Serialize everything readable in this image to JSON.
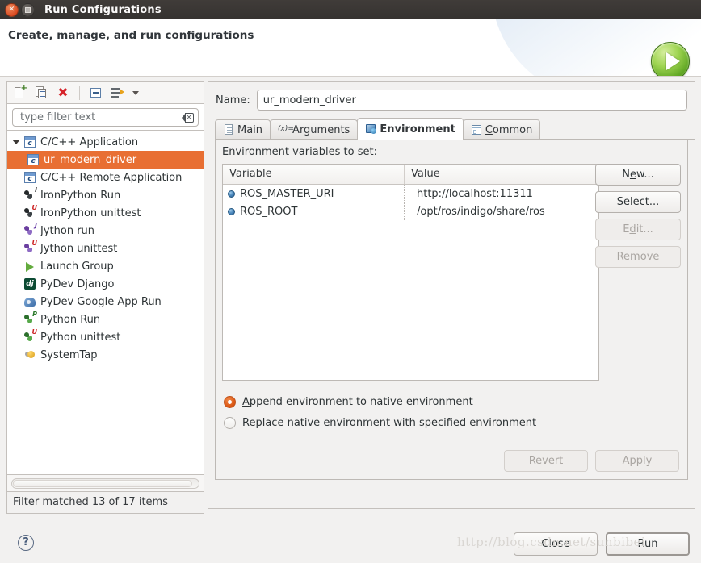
{
  "window": {
    "title": "Run Configurations",
    "close_icon": "close-icon",
    "maximize_icon": "maximize-icon"
  },
  "header": {
    "title": "Create, manage, and run configurations",
    "run_badge_icon": "run-play-icon"
  },
  "left_panel": {
    "toolbar": [
      {
        "name": "new-configuration-icon",
        "label": "New launch configuration"
      },
      {
        "name": "duplicate-configuration-icon",
        "label": "Duplicate"
      },
      {
        "name": "delete-configuration-icon",
        "label": "Delete"
      },
      {
        "name": "collapse-all-icon",
        "label": "Collapse All"
      },
      {
        "name": "filter-launch-configurations-icon",
        "label": "Filter"
      },
      {
        "name": "chevron-down-icon",
        "label": "View Menu"
      }
    ],
    "filter": {
      "placeholder": "type filter text",
      "value": "",
      "clear_icon": "clear-field-icon"
    },
    "tree": [
      {
        "label": "C/C++ Application",
        "icon": "c-app-icon",
        "level": 0,
        "expanded": true,
        "selected": false
      },
      {
        "label": "ur_modern_driver",
        "icon": "c-app-icon",
        "level": 1,
        "expanded": false,
        "selected": true
      },
      {
        "label": "C/C++ Remote Application",
        "icon": "c-app-icon",
        "level": 0,
        "expanded": false,
        "selected": false
      },
      {
        "label": "IronPython Run",
        "icon": "ironpython-run-icon",
        "level": 0,
        "expanded": false,
        "selected": false
      },
      {
        "label": "IronPython unittest",
        "icon": "ironpython-unittest-icon",
        "level": 0,
        "expanded": false,
        "selected": false
      },
      {
        "label": "Jython run",
        "icon": "jython-run-icon",
        "level": 0,
        "expanded": false,
        "selected": false
      },
      {
        "label": "Jython unittest",
        "icon": "jython-unittest-icon",
        "level": 0,
        "expanded": false,
        "selected": false
      },
      {
        "label": "Launch Group",
        "icon": "launch-group-icon",
        "level": 0,
        "expanded": false,
        "selected": false
      },
      {
        "label": "PyDev Django",
        "icon": "pydev-django-icon",
        "level": 0,
        "expanded": false,
        "selected": false
      },
      {
        "label": "PyDev Google App Run",
        "icon": "pydev-google-app-icon",
        "level": 0,
        "expanded": false,
        "selected": false
      },
      {
        "label": "Python Run",
        "icon": "python-run-icon",
        "level": 0,
        "expanded": false,
        "selected": false
      },
      {
        "label": "Python unittest",
        "icon": "python-unittest-icon",
        "level": 0,
        "expanded": false,
        "selected": false
      },
      {
        "label": "SystemTap",
        "icon": "systemtap-icon",
        "level": 0,
        "expanded": false,
        "selected": false
      }
    ],
    "status": "Filter matched 13 of 17 items",
    "selection_color": "#e86f33"
  },
  "right_panel": {
    "name_label": "Name:",
    "name_value": "ur_modern_driver",
    "tabs": [
      {
        "label": "Main",
        "icon": "main-tab-icon",
        "active": false
      },
      {
        "label": "Arguments",
        "icon": "arguments-tab-icon",
        "active": false
      },
      {
        "label": "Environment",
        "icon": "environment-tab-icon",
        "active": true
      },
      {
        "label": "Common",
        "icon": "common-tab-icon",
        "active": false
      }
    ],
    "environment": {
      "section_label": "Environment variables to set:",
      "columns": [
        "Variable",
        "Value"
      ],
      "rows": [
        {
          "variable": "ROS_MASTER_URI",
          "value": "http://localhost:11311"
        },
        {
          "variable": "ROS_ROOT",
          "value": "/opt/ros/indigo/share/ros"
        }
      ],
      "buttons": [
        {
          "label": "New...",
          "enabled": true
        },
        {
          "label": "Select...",
          "enabled": true
        },
        {
          "label": "Edit...",
          "enabled": false
        },
        {
          "label": "Remove",
          "enabled": false
        }
      ],
      "radio_options": [
        {
          "label": "Append environment to native environment",
          "selected": true
        },
        {
          "label": "Replace native environment with specified environment",
          "selected": false
        }
      ],
      "radio_accent": "#dd5a17"
    },
    "apply_buttons": [
      {
        "label": "Revert",
        "enabled": false
      },
      {
        "label": "Apply",
        "enabled": false
      }
    ]
  },
  "footer": {
    "help_icon": "help-icon",
    "buttons": [
      {
        "label": "Close",
        "default": false
      },
      {
        "label": "Run",
        "default": true
      }
    ]
  },
  "watermark": "http://blog.csdn.net/sunbibei"
}
